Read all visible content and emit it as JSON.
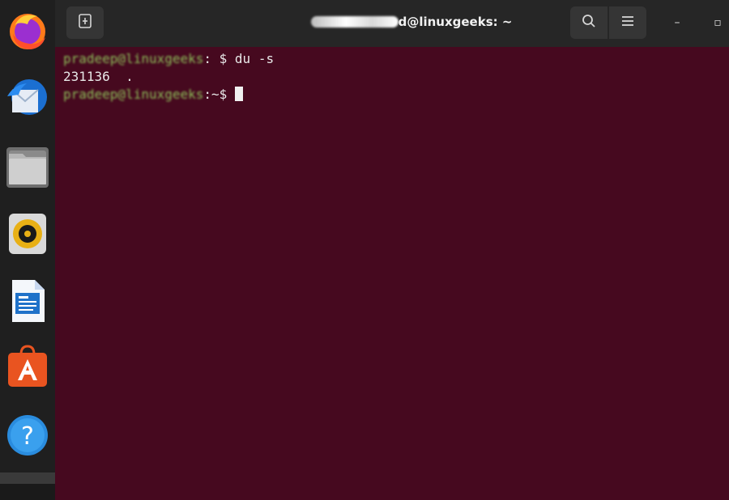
{
  "dock": {
    "items": [
      {
        "name": "Firefox",
        "icon": "firefox-icon"
      },
      {
        "name": "Thunderbird",
        "icon": "thunderbird-icon"
      },
      {
        "name": "Files",
        "icon": "files-icon"
      },
      {
        "name": "Rhythmbox",
        "icon": "rhythmbox-icon"
      },
      {
        "name": "LibreOffice Writer",
        "icon": "writer-icon"
      },
      {
        "name": "Ubuntu Software",
        "icon": "software-center-icon"
      },
      {
        "name": "Help",
        "icon": "help-icon"
      }
    ]
  },
  "window": {
    "title_suffix": "d@linuxgeeks: ~",
    "controls": {
      "minimize": "–",
      "maximize": "▫"
    }
  },
  "terminal": {
    "line1": {
      "prompt_user": "pradeep@linuxgeeks",
      "path": "",
      "sym": ": $ ",
      "command": "du -s"
    },
    "line2": {
      "output": "231136\t."
    },
    "line3": {
      "prompt_user": "pradeep@linuxgeeks",
      "path": "",
      "sym": ":~$ "
    }
  },
  "colors": {
    "terminal_bg": "#46091f",
    "headerbar_bg": "#262626",
    "dock_bg": "#1f1f1f",
    "prompt_user": "#8ec05a",
    "text": "#e8e8e8"
  }
}
